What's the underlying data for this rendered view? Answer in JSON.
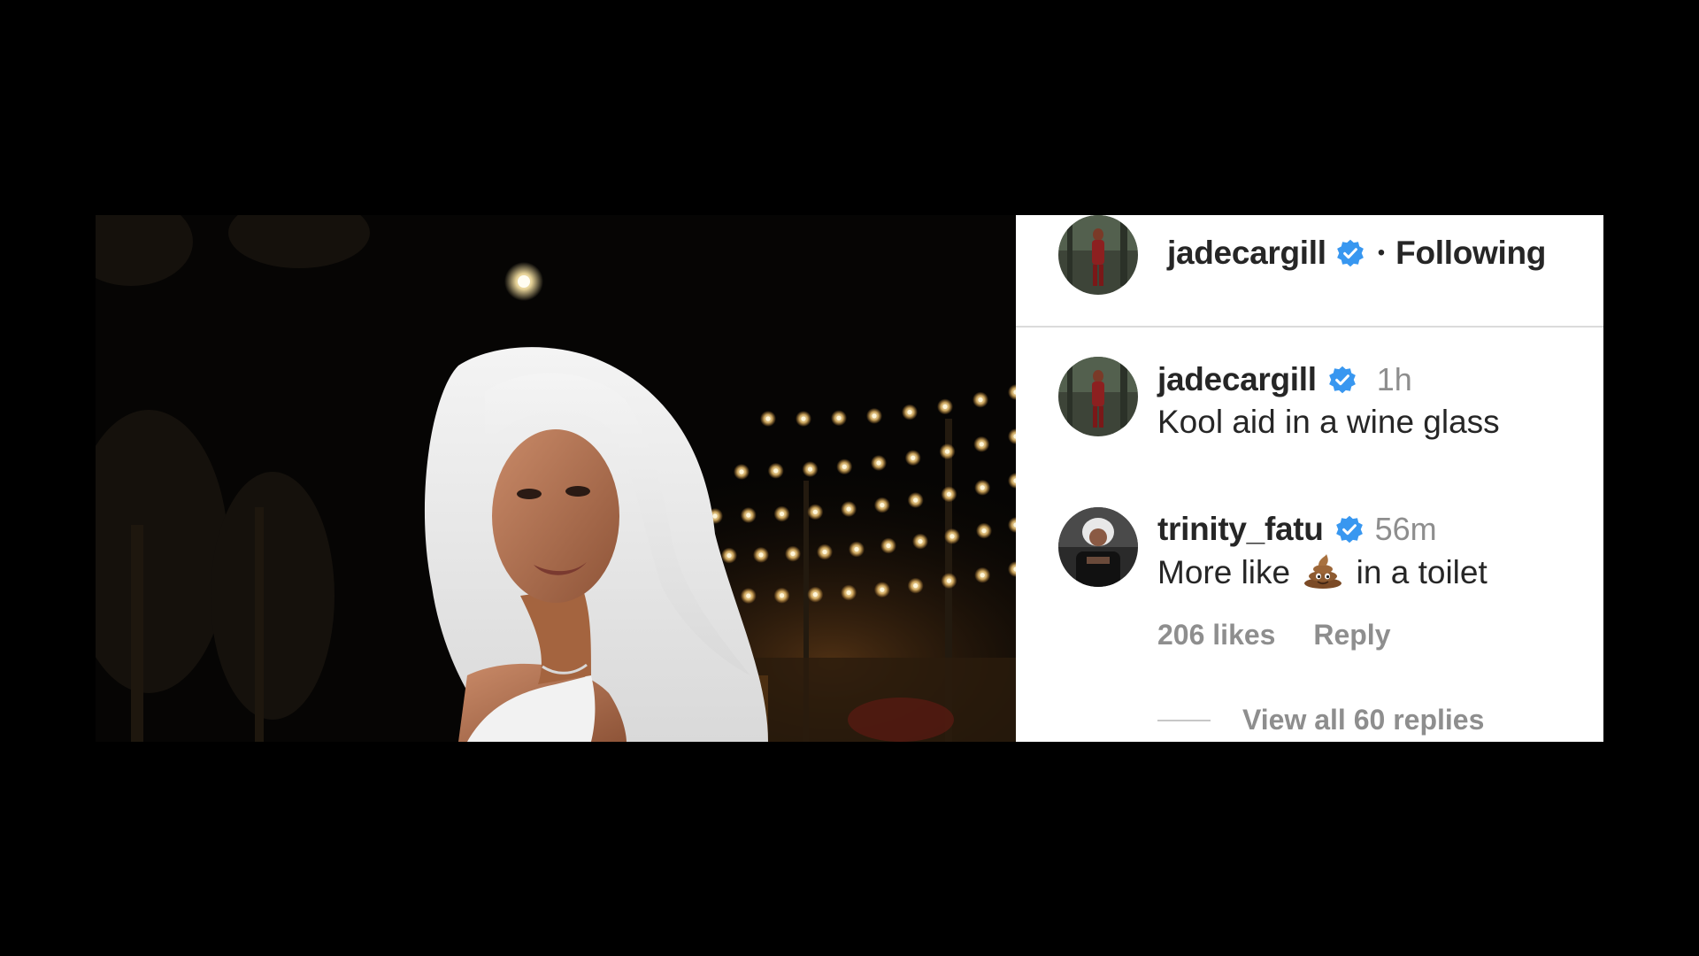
{
  "post": {
    "author": {
      "username": "jadecargill",
      "verified": true,
      "follow_status": "Following",
      "separator": "•"
    }
  },
  "comments": [
    {
      "username": "jadecargill",
      "verified": true,
      "time": "1h",
      "text": "Kool aid in a wine glass"
    },
    {
      "username": "trinity_fatu",
      "verified": true,
      "time": "56m",
      "text_before": "More like",
      "emoji": "pile-of-poo-icon",
      "text_after": "in a toilet",
      "likes": "206 likes",
      "reply_label": "Reply",
      "view_replies": "View all 60 replies"
    }
  ],
  "colors": {
    "verified_blue": "#3897f0",
    "text_primary": "#262626",
    "text_secondary": "#8e8e8e",
    "divider": "#dbdbdb"
  }
}
